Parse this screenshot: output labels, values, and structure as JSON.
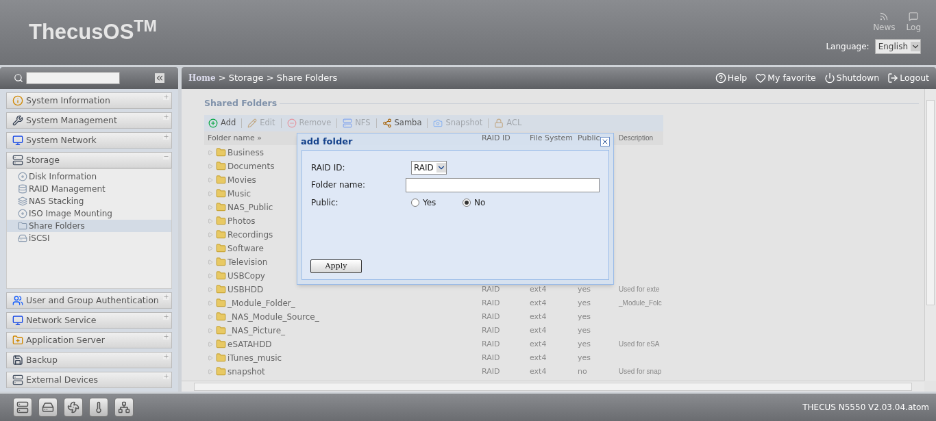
{
  "header": {
    "logo": "ThecusOS$^{TM}$",
    "links": [
      {
        "kind": "news",
        "label": "News"
      },
      {
        "kind": "log",
        "label": "Log"
      }
    ],
    "language_label": "Language:",
    "language": "English"
  },
  "sidebar": {
    "groups": [
      {
        "kind": "info",
        "label": "System Information",
        "expanded": false
      },
      {
        "kind": "tools",
        "label": "System Management",
        "expanded": false
      },
      {
        "kind": "network",
        "label": "System Network",
        "expanded": false
      },
      {
        "kind": "storage",
        "label": "Storage",
        "expanded": true,
        "children": [
          {
            "kind": "disk",
            "label": "Disk Information",
            "selected": false
          },
          {
            "kind": "raid",
            "label": "RAID Management",
            "selected": false
          },
          {
            "kind": "stack",
            "label": "NAS Stacking",
            "selected": false
          },
          {
            "kind": "iso",
            "label": "ISO Image Mounting",
            "selected": false
          },
          {
            "kind": "share",
            "label": "Share Folders",
            "selected": true
          },
          {
            "kind": "iscsi",
            "label": "iSCSI",
            "selected": false
          }
        ]
      },
      {
        "kind": "users",
        "label": "User and Group Authentication",
        "expanded": false
      },
      {
        "kind": "network",
        "label": "Network Service",
        "expanded": false
      },
      {
        "kind": "app",
        "label": "Application Server",
        "expanded": false
      },
      {
        "kind": "backup",
        "label": "Backup",
        "expanded": false
      },
      {
        "kind": "storage",
        "label": "External Devices",
        "expanded": false
      }
    ]
  },
  "breadcrumb": {
    "home": "Home",
    "path": "> Storage > Share Folders"
  },
  "top_actions": [
    {
      "kind": "help",
      "label": "Help"
    },
    {
      "kind": "favorite",
      "label": "My favorite"
    },
    {
      "kind": "power",
      "label": "Shutdown"
    },
    {
      "kind": "logout",
      "label": "Logout"
    }
  ],
  "section_title": "Shared Folders",
  "toolbar": [
    {
      "kind": "add",
      "label": "Add",
      "disabled": false
    },
    {
      "kind": "edit",
      "label": "Edit",
      "disabled": true
    },
    {
      "kind": "remove",
      "label": "Remove",
      "disabled": true
    },
    {
      "kind": "nfs",
      "label": "NFS",
      "disabled": true
    },
    {
      "kind": "samba",
      "label": "Samba",
      "disabled": false
    },
    {
      "kind": "snapshot",
      "label": "Snapshot",
      "disabled": true
    },
    {
      "kind": "acl",
      "label": "ACL",
      "disabled": true
    }
  ],
  "table": {
    "columns": [
      "Folder name »",
      "RAID ID",
      "File System",
      "Public",
      "Description"
    ],
    "rows": [
      {
        "name": "Business"
      },
      {
        "name": "Documents"
      },
      {
        "name": "Movies"
      },
      {
        "name": "Music"
      },
      {
        "name": "NAS_Public"
      },
      {
        "name": "Photos"
      },
      {
        "name": "Recordings"
      },
      {
        "name": "Software"
      },
      {
        "name": "Television"
      },
      {
        "name": "USBCopy"
      },
      {
        "name": "USBHDD",
        "raid": "RAID",
        "fs": "ext4",
        "public": "yes",
        "description": "Used for exte"
      },
      {
        "name": "_Module_Folder_",
        "raid": "RAID",
        "fs": "ext4",
        "public": "yes",
        "description": "_Module_Folc"
      },
      {
        "name": "_NAS_Module_Source_",
        "raid": "RAID",
        "fs": "ext4",
        "public": "yes"
      },
      {
        "name": "_NAS_Picture_",
        "raid": "RAID",
        "fs": "ext4",
        "public": "yes"
      },
      {
        "name": "eSATAHDD",
        "raid": "RAID",
        "fs": "ext4",
        "public": "yes",
        "description": "Used for eSA"
      },
      {
        "name": "iTunes_music",
        "raid": "RAID",
        "fs": "ext4",
        "public": "yes"
      },
      {
        "name": "snapshot",
        "raid": "RAID",
        "fs": "ext4",
        "public": "no",
        "description": "Used for snap"
      }
    ]
  },
  "dialog": {
    "title": "add folder",
    "raid_label": "RAID ID:",
    "raid_value": "RAID",
    "name_label": "Folder name:",
    "public_label": "Public:",
    "options": [
      {
        "label": "Yes",
        "selected": false
      },
      {
        "label": "No",
        "selected": true
      }
    ],
    "apply": "Apply"
  },
  "footer": {
    "icons": [
      {
        "kind": "server"
      },
      {
        "kind": "disk"
      },
      {
        "kind": "fan"
      },
      {
        "kind": "thermometer"
      },
      {
        "kind": "network"
      }
    ],
    "version": "THECUS N5550 V2.03.04.atom"
  }
}
